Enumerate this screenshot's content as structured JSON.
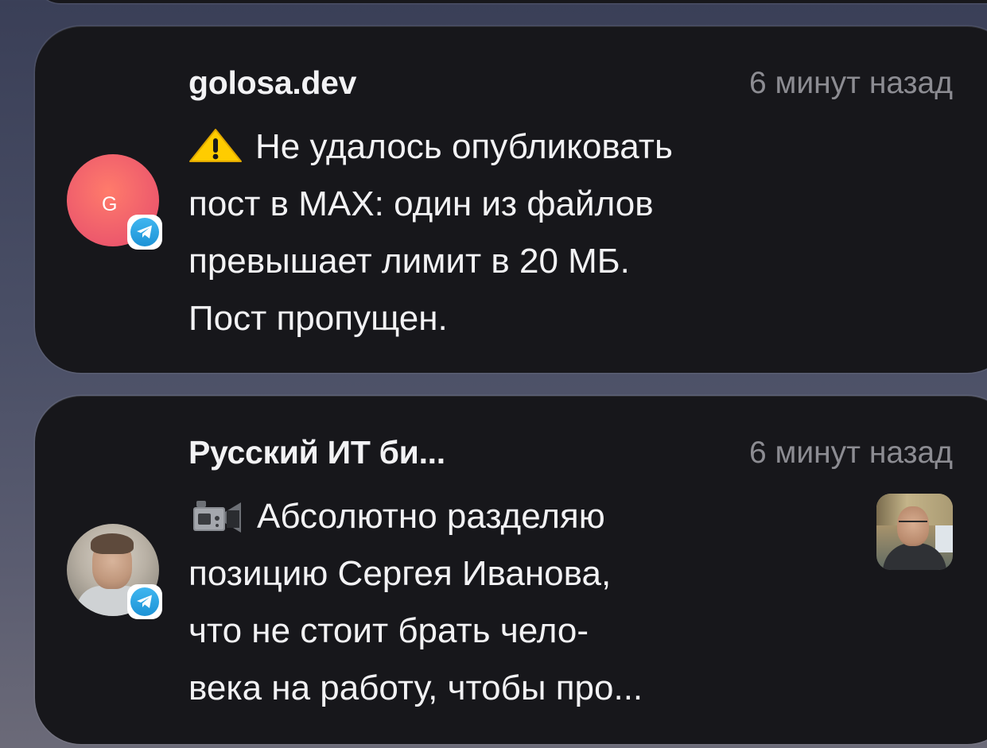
{
  "notifications": [
    {
      "app_icon": "telegram-icon",
      "avatar_letter": "G",
      "title": "golosa.dev",
      "time": "6 минут назад",
      "emoji": "warning-icon",
      "body_lines": [
        "Не удалось опубликовать",
        "пост в MAX: один из файлов",
        "превышает лимит в 20 МБ.",
        "Пост пропущен."
      ]
    },
    {
      "app_icon": "telegram-icon",
      "title": "Русский ИТ би...",
      "time": "6 минут назад",
      "emoji": "video-camera-icon",
      "body_lines": [
        "Абсолютно разделяю",
        "позицию Сергея Иванова,",
        "что не стоит брать чело-",
        "века на работу, чтобы про..."
      ]
    }
  ],
  "colors": {
    "card_background": "#17171b",
    "title_text": "#f2f2f4",
    "time_text": "#8c8c92",
    "avatar_g": "#f0606c",
    "telegram_blue": "#1d93d6"
  }
}
